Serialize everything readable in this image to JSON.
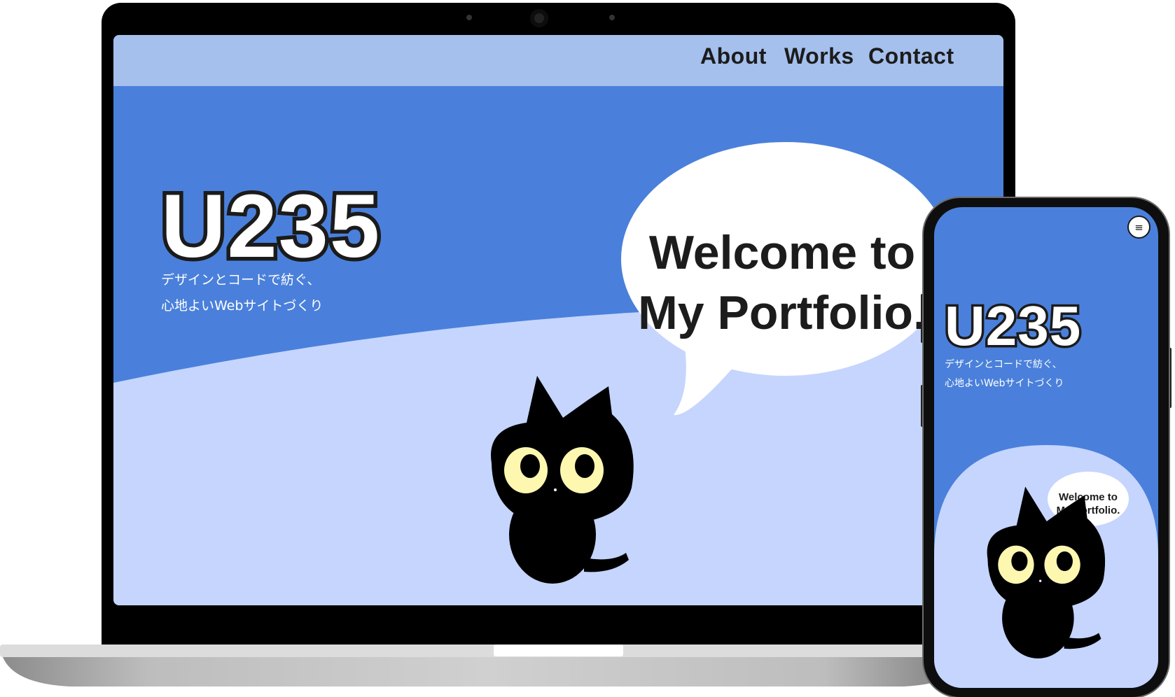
{
  "desktop": {
    "nav": {
      "items": [
        {
          "label": "About"
        },
        {
          "label": "Works"
        },
        {
          "label": "Contact"
        }
      ]
    },
    "hero": {
      "logo": "U235",
      "tagline_line1": "デザインとコードで紡ぐ、",
      "tagline_line2": "心地よいWebサイトづくり",
      "bubble_line1": "Welcome to",
      "bubble_line2": "My Portfolio."
    }
  },
  "mobile": {
    "menu_icon": "≡",
    "hero": {
      "logo": "U235",
      "tagline_line1": "デザインとコードで紡ぐ、",
      "tagline_line2": "心地よいWebサイトづくり",
      "bubble_line1": "Welcome to",
      "bubble_line2": "My Portfolio."
    }
  },
  "colors": {
    "hero_blue": "#4a80db",
    "nav_blue": "#a5c0ed",
    "hill_blue": "#c5d5fd",
    "cat_black": "#000000",
    "cat_eye": "#fdf7b0"
  },
  "icons": {
    "menu": "hamburger-menu-icon",
    "mascot": "black-cat-mascot"
  }
}
